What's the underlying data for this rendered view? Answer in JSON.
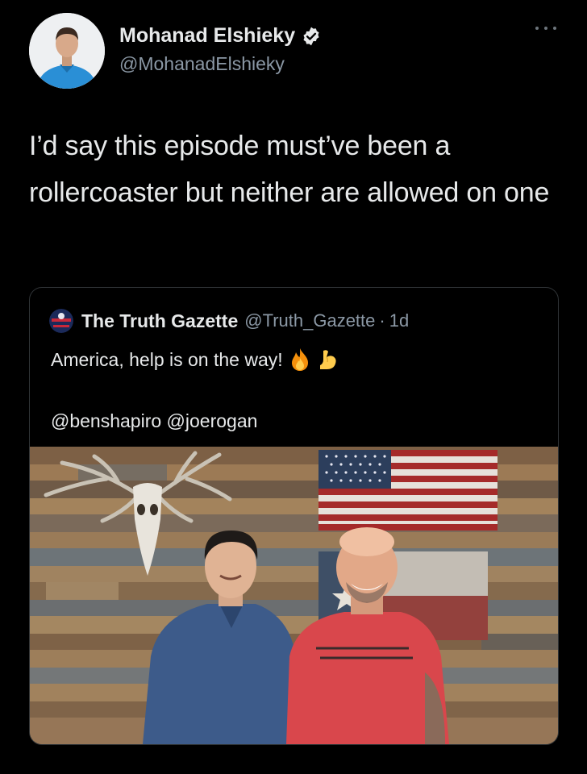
{
  "tweet": {
    "author_name": "Mohanad Elshieky",
    "author_handle": "@MohanadElshieky",
    "text": "I’d say this episode must’ve been a rollercoaster but neither are allowed on one",
    "more_icon": "more-horizontal-icon",
    "verified_icon": "verified-badge-icon"
  },
  "quoted_tweet": {
    "author_name": "The Truth Gazette",
    "author_handle": "@Truth_Gazette",
    "separator": "·",
    "time": "1d",
    "text": "America, help is on the way!",
    "emojis": [
      "fire-emoji",
      "flexed-biceps-emoji"
    ],
    "mentions": "@benshapiro @joerogan"
  },
  "colors": {
    "background": "#000000",
    "text_primary": "#e7e9ea",
    "text_secondary": "#8b98a5",
    "card_border": "#2f3336"
  }
}
